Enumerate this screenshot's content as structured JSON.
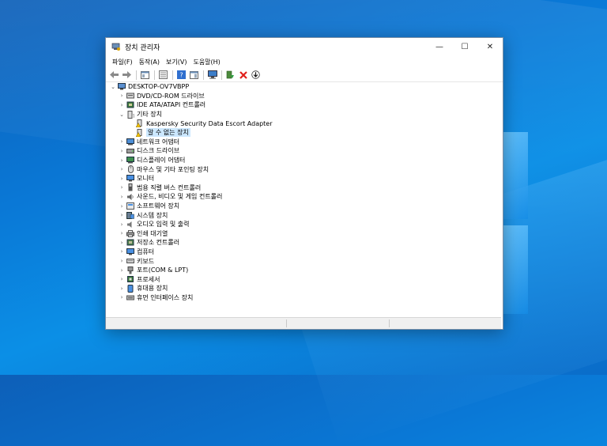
{
  "window": {
    "title": "장치 관리자"
  },
  "controls": {
    "minimize": "—",
    "maximize": "☐",
    "close": "✕"
  },
  "menu": [
    "파일(F)",
    "동작(A)",
    "보기(V)",
    "도움말(H)"
  ],
  "tree": {
    "root": "DESKTOP-OV7VBPP",
    "items": [
      {
        "label": "DVD/CD-ROM 드라이브",
        "icon": "dvd-drive-icon",
        "expanded": false
      },
      {
        "label": "IDE ATA/ATAPI 컨트롤러",
        "icon": "ide-controller-icon",
        "expanded": false
      },
      {
        "label": "기타 장치",
        "icon": "other-devices-icon",
        "expanded": true,
        "children": [
          {
            "label": "Kaspersky Security Data Escort Adapter",
            "icon": "warning-device-icon"
          },
          {
            "label": "알 수 없는 장치",
            "icon": "warning-device-icon",
            "selected": true
          }
        ]
      },
      {
        "label": "네트워크 어댑터",
        "icon": "network-adapter-icon",
        "expanded": false
      },
      {
        "label": "디스크 드라이브",
        "icon": "disk-drive-icon",
        "expanded": false
      },
      {
        "label": "디스플레이 어댑터",
        "icon": "display-adapter-icon",
        "expanded": false
      },
      {
        "label": "마우스 및 기타 포인팅 장치",
        "icon": "mouse-icon",
        "expanded": false
      },
      {
        "label": "모니터",
        "icon": "monitor-icon",
        "expanded": false
      },
      {
        "label": "범용 직렬 버스 컨트롤러",
        "icon": "usb-icon",
        "expanded": false
      },
      {
        "label": "사운드, 비디오 및 게임 컨트롤러",
        "icon": "sound-icon",
        "expanded": false
      },
      {
        "label": "소프트웨어 장치",
        "icon": "software-device-icon",
        "expanded": false
      },
      {
        "label": "시스템 장치",
        "icon": "system-device-icon",
        "expanded": false
      },
      {
        "label": "오디오 입력 및 출력",
        "icon": "audio-io-icon",
        "expanded": false
      },
      {
        "label": "인쇄 대기열",
        "icon": "printer-icon",
        "expanded": false
      },
      {
        "label": "저장소 컨트롤러",
        "icon": "storage-controller-icon",
        "expanded": false
      },
      {
        "label": "컴퓨터",
        "icon": "computer-icon",
        "expanded": false
      },
      {
        "label": "키보드",
        "icon": "keyboard-icon",
        "expanded": false
      },
      {
        "label": "포트(COM & LPT)",
        "icon": "port-icon",
        "expanded": false
      },
      {
        "label": "프로세서",
        "icon": "processor-icon",
        "expanded": false
      },
      {
        "label": "휴대용 장치",
        "icon": "portable-device-icon",
        "expanded": false
      },
      {
        "label": "휴먼 인터페이스 장치",
        "icon": "hid-icon",
        "expanded": false
      }
    ]
  },
  "colors": {
    "selection": "#cce8ff",
    "desktop": "#0a78d6"
  }
}
